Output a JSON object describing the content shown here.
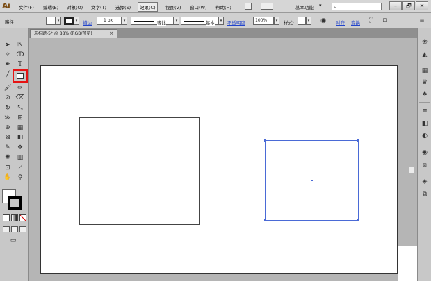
{
  "app": {
    "logo": "Ai"
  },
  "menu": [
    {
      "label": "文件(F)"
    },
    {
      "label": "编辑(E)"
    },
    {
      "label": "对象(O)"
    },
    {
      "label": "文字(T)"
    },
    {
      "label": "选择(S)"
    },
    {
      "label": "效果(C)",
      "active": true
    },
    {
      "label": "视图(V)"
    },
    {
      "label": "窗口(W)"
    },
    {
      "label": "帮助(H)"
    }
  ],
  "workspace": {
    "label": "基本功能"
  },
  "window_controls": {
    "minimize": "–",
    "restore": "🗗",
    "close": "✕"
  },
  "control_bar": {
    "path_label": "路径",
    "stroke_link": "描边",
    "stroke_weight": "1 px",
    "profile_label": "等比",
    "brush_label": "基本",
    "opacity_link": "不透明度",
    "opacity_value": "100%",
    "style_label": "样式:",
    "align_link": "对齐",
    "transform_link": "变换"
  },
  "document": {
    "tab_title": "未标题-5* @ 88% (RGB/预览)",
    "tab_close": "×"
  },
  "colors": {
    "selection": "#4a6ad6",
    "highlight": "#e61414"
  }
}
